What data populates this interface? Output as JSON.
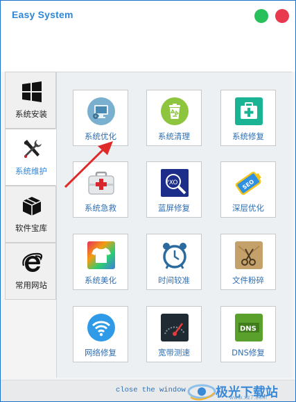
{
  "window": {
    "title": "Easy System"
  },
  "sidebar": {
    "items": [
      {
        "label": "系统安装",
        "icon": "windows-logo-icon",
        "active": false
      },
      {
        "label": "系统维护",
        "icon": "tools-icon",
        "active": true
      },
      {
        "label": "软件宝库",
        "icon": "package-box-icon",
        "active": false
      },
      {
        "label": "常用网站",
        "icon": "internet-explorer-icon",
        "active": false
      }
    ]
  },
  "tools": [
    {
      "label": "系统优化",
      "icon": "monitor-gear-icon"
    },
    {
      "label": "系统清理",
      "icon": "recycle-bin-icon"
    },
    {
      "label": "系统修复",
      "icon": "first-aid-kit-icon"
    },
    {
      "label": "系统急救",
      "icon": "medical-toolbox-icon"
    },
    {
      "label": "蓝屏修复",
      "icon": "bluescreen-magnifier-icon"
    },
    {
      "label": "深层优化",
      "icon": "seo-battery-icon"
    },
    {
      "label": "系统美化",
      "icon": "tshirt-icon"
    },
    {
      "label": "时间较准",
      "icon": "alarm-clock-icon"
    },
    {
      "label": "文件粉碎",
      "icon": "scissors-envelope-icon"
    },
    {
      "label": "网络修复",
      "icon": "wifi-icon"
    },
    {
      "label": "宽带测速",
      "icon": "speedometer-icon"
    },
    {
      "label": "DNS修复",
      "icon": "dns-icon"
    }
  ],
  "footer": {
    "close_label": "close the window"
  },
  "watermark": {
    "text": "极光下载站",
    "url": "www.xz7.com"
  },
  "colors": {
    "accent": "#2f86d8",
    "minimize": "#27c05a",
    "close": "#e8394f",
    "annotation_arrow": "#e02a2a"
  }
}
